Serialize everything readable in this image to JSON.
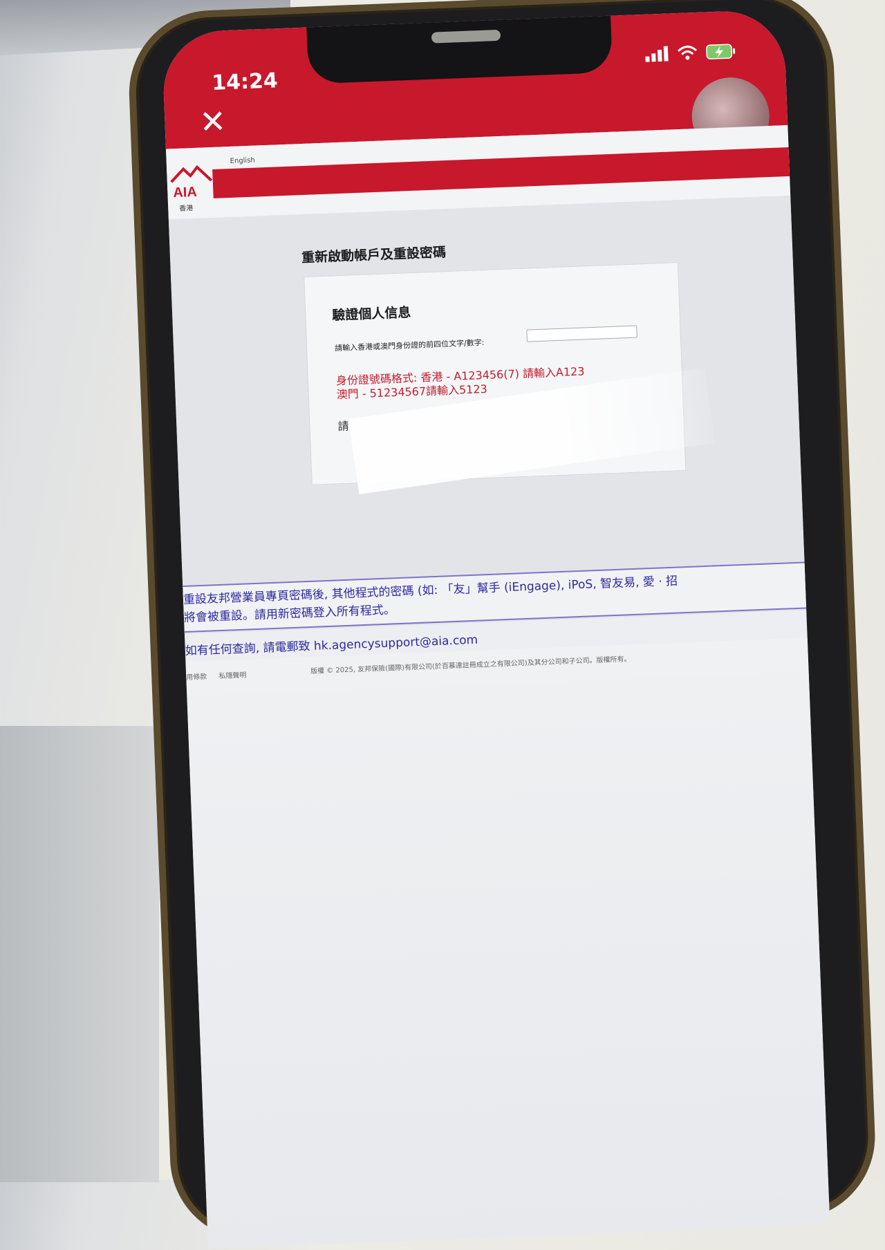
{
  "status_bar": {
    "time": "14:24",
    "icons": [
      "signal-icon",
      "wifi-icon",
      "battery-charging-icon"
    ]
  },
  "browser": {
    "close_icon": "close-icon",
    "close_glyph": "✕"
  },
  "header": {
    "logo_text": "AIA",
    "logo_subtext": "香港",
    "language_link": "English"
  },
  "main": {
    "page_title": "重新啟動帳戶及重設密碼",
    "card": {
      "title": "驗證個人信息",
      "id_field_label": "請輸入香港或澳門身份證的前四位文字/數字:",
      "id_field_value": "",
      "format_line_1": "身份證號碼格式:  香港 - A123456(7) 請輸入A123",
      "format_line_2": "澳門 - 51234567請輸入5123",
      "hint_prefix": "請"
    }
  },
  "notice": {
    "line_1": "重設友邦營業員專頁密碼後, 其他程式的密碼 (如: 「友」幫手 (iEngage), iPoS, 智友易, 愛 · 招",
    "line_2": "將會被重設。請用新密碼登入所有程式。"
  },
  "enquiry": "如有任何查詢, 請電郵致 hk.agencysupport@aia.com",
  "footer": {
    "links": [
      "用條款",
      "私隱聲明"
    ],
    "copyright": "版權 © 2025, 友邦保險(國際)有限公司(於百慕達註冊成立之有限公司)及其分公司和子公司。版權所有。"
  },
  "colors": {
    "brand_red": "#c8182c",
    "notice_blue": "#2d2a9f",
    "warning_red": "#c01d2a"
  }
}
